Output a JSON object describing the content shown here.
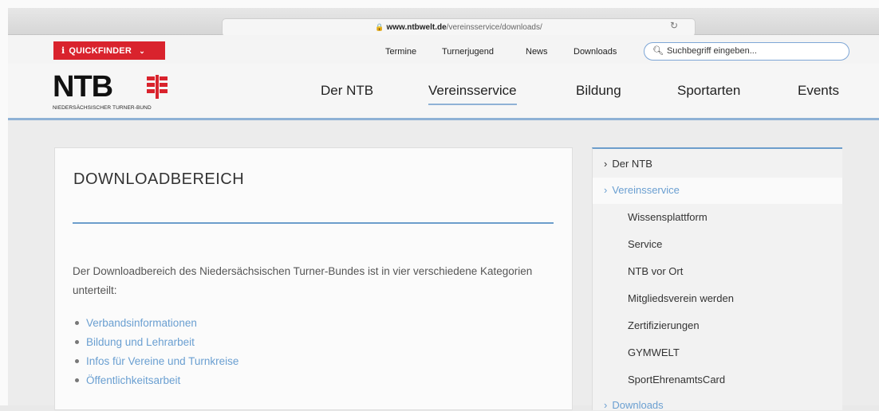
{
  "browser": {
    "url_host": "www.ntbwelt.de",
    "url_path": "/vereinsservice/downloads/"
  },
  "utility": {
    "quickfinder_label": "QUICKFINDER",
    "links": [
      "Termine",
      "Turnerjugend",
      "News",
      "Downloads"
    ],
    "search_placeholder": "Suchbegriff eingeben..."
  },
  "logo": {
    "wordmark": "NTB",
    "subtitle": "NIEDERSÄCHSISCHER TURNER-BUND"
  },
  "nav": {
    "items": [
      "Der NTB",
      "Vereinsservice",
      "Bildung",
      "Sportarten",
      "Events"
    ],
    "active": "Vereinsservice"
  },
  "main": {
    "title": "DOWNLOADBEREICH",
    "intro": "Der Downloadbereich des Niedersächsischen Turner-Bundes ist in vier verschiedene Kategorien unterteilt:",
    "categories": [
      "Verbandsinformationen",
      "Bildung und Lehrarbeit",
      "Infos für Vereine und Turnkreise",
      "Öffentlichkeitsarbeit"
    ]
  },
  "sidebar": {
    "items": [
      "Der NTB",
      "Vereinsservice",
      "Wissensplattform",
      "Service",
      "NTB vor Ort",
      "Mitgliedsverein werden",
      "Zertifizierungen",
      "GYMWELT",
      "SportEhrenamtsCard",
      "Downloads"
    ]
  },
  "colors": {
    "accent_blue": "#6c9dcb",
    "quickfinder_red": "#d9232d",
    "link_blue": "#6a9fd1"
  }
}
